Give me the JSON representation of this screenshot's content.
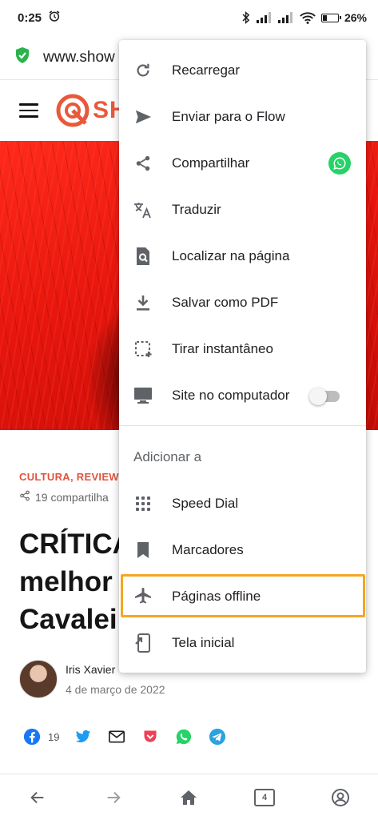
{
  "status_bar": {
    "time": "0:25",
    "battery_text": "26%",
    "battery_level": 0.26,
    "icons": [
      "alarm-icon",
      "bluetooth-icon",
      "signal-icon",
      "signal-icon",
      "wifi-icon",
      "battery-icon"
    ]
  },
  "url_bar": {
    "url_visible": "www.show",
    "security_icon": "shield-check-icon",
    "accent": "#2bb24c"
  },
  "site_header": {
    "logo_text": "SH",
    "brand_color": "#e8593c"
  },
  "article": {
    "categories": "CULTURA, REVIEWS",
    "separator": "·",
    "shares": "19 compartilha",
    "headline_lines": [
      "CRÍTICA",
      "melhor",
      "Cavalei"
    ],
    "author_name": "Iris Xavier",
    "date": "4 de março de 2022",
    "facebook_count": "19"
  },
  "menu": {
    "items": [
      {
        "label": "Recarregar",
        "icon": "reload-icon"
      },
      {
        "label": "Enviar para o Flow",
        "icon": "send-icon"
      },
      {
        "label": "Compartilhar",
        "icon": "share-icon"
      },
      {
        "label": "Traduzir",
        "icon": "translate-icon"
      },
      {
        "label": "Localizar na página",
        "icon": "find-in-page-icon"
      },
      {
        "label": "Salvar como PDF",
        "icon": "download-icon"
      },
      {
        "label": "Tirar instantâneo",
        "icon": "snapshot-icon"
      },
      {
        "label": "Site no computador",
        "icon": "desktop-icon",
        "toggle": false
      }
    ],
    "section_title": "Adicionar a",
    "add_items": [
      {
        "label": "Speed Dial",
        "icon": "speed-dial-icon"
      },
      {
        "label": "Marcadores",
        "icon": "bookmark-icon"
      },
      {
        "label": "Páginas offline",
        "icon": "airplane-icon",
        "highlighted": true
      },
      {
        "label": "Tela inicial",
        "icon": "home-screen-icon"
      }
    ],
    "highlight_color": "#f5a623"
  },
  "bottom_nav": {
    "tab_count": "4",
    "items": [
      "back-icon",
      "forward-icon",
      "home-icon",
      "tabs-icon",
      "account-icon"
    ]
  }
}
